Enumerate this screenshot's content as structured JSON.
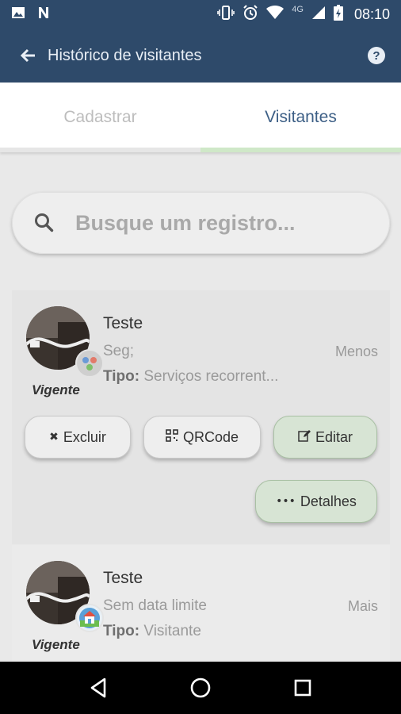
{
  "status_bar": {
    "time": "08:10",
    "network": "4G",
    "icons": [
      "image-icon",
      "n-app-icon",
      "vibrate-icon",
      "alarm-icon",
      "wifi-icon",
      "signal-icon",
      "battery-icon"
    ]
  },
  "app_bar": {
    "title": "Histórico de visitantes",
    "back_icon": "arrow-left-icon",
    "help_icon": "help-icon"
  },
  "tabs": [
    {
      "label": "Cadastrar",
      "active": false
    },
    {
      "label": "Visitantes",
      "active": true
    }
  ],
  "search": {
    "placeholder": "Busque um registro..."
  },
  "cards": [
    {
      "name": "Teste",
      "period": "Seg;",
      "level": "Menos",
      "type_label": "Tipo:",
      "type_value": "Serviços recorrent...",
      "status": "Vigente",
      "badge_icon": "services-badge-icon",
      "buttons": {
        "delete": "Excluir",
        "qrcode": "QRCode",
        "edit": "Editar",
        "details": "Detalhes"
      }
    },
    {
      "name": "Teste",
      "period": "Sem data limite",
      "level": "Mais",
      "type_label": "Tipo:",
      "type_value": "Visitante",
      "status": "Vigente",
      "badge_icon": "home-badge-icon"
    }
  ],
  "colors": {
    "header": "#2e4a6a",
    "active_tab": "#3d5f86",
    "tab_indicator": "#cfe8c8",
    "green_button": "#d7e4d4"
  }
}
